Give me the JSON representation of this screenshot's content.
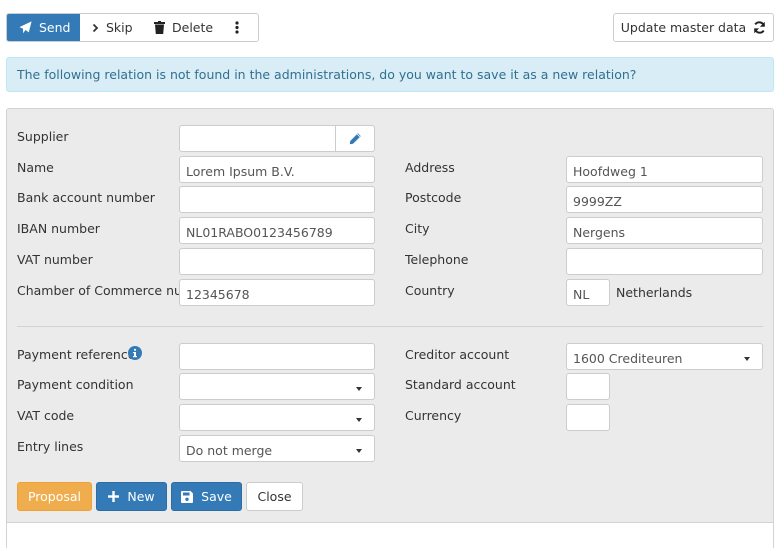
{
  "toolbar": {
    "send_label": "Send",
    "skip_label": "Skip",
    "delete_label": "Delete",
    "more_icon": "vertical-ellipsis-icon",
    "update_master_data_label": "Update master data"
  },
  "alert": {
    "message": "The following relation is not found in the administrations, do you want to save it as a new relation?"
  },
  "form": {
    "left": [
      {
        "label": "Supplier",
        "value": ""
      },
      {
        "label": "Name",
        "value": "Lorem Ipsum B.V."
      },
      {
        "label": "Bank account number",
        "value": ""
      },
      {
        "label": "IBAN number",
        "value": "NL01RABO0123456789"
      },
      {
        "label": "VAT number",
        "value": ""
      },
      {
        "label": "Chamber of Commerce number",
        "value": "12345678"
      }
    ],
    "right": [
      {
        "label": "Address",
        "value": "Hoofdweg 1"
      },
      {
        "label": "Postcode",
        "value": "9999ZZ"
      },
      {
        "label": "City",
        "value": "Nergens"
      },
      {
        "label": "Telephone",
        "value": ""
      },
      {
        "label": "Country",
        "value": "NL",
        "country_name": "Netherlands"
      }
    ],
    "left2": [
      {
        "label": "Payment reference",
        "value": ""
      },
      {
        "label": "Payment condition",
        "value": ""
      },
      {
        "label": "VAT code",
        "value": ""
      },
      {
        "label": "Entry lines",
        "value": "Do not merge"
      }
    ],
    "right2": [
      {
        "label": "Creditor account",
        "value": "1600 Crediteuren"
      },
      {
        "label": "Standard account",
        "value": ""
      },
      {
        "label": "Currency",
        "value": ""
      }
    ]
  },
  "footer_buttons": {
    "proposal": "Proposal",
    "new": "New",
    "save": "Save",
    "close": "Close"
  },
  "colors": {
    "primary": "#337ab7",
    "warning": "#f0ad4e",
    "alert_bg": "#d9edf7",
    "alert_text": "#31708f"
  }
}
